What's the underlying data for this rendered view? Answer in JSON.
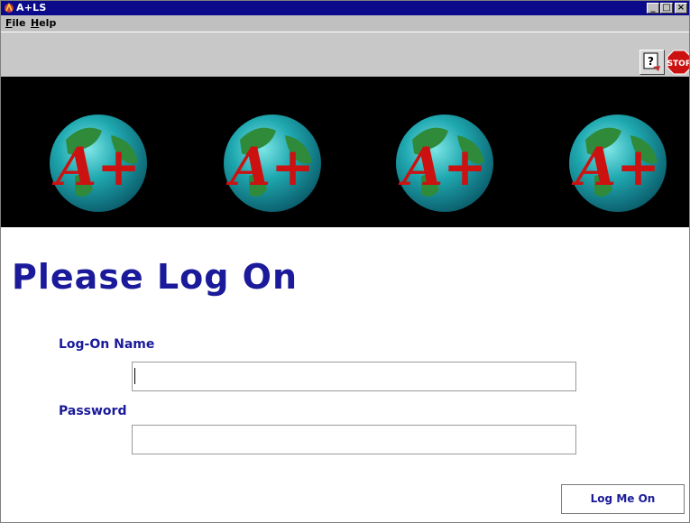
{
  "window": {
    "title": "A+LS",
    "colors": {
      "titlebar": "#0a0a8a",
      "accent_text": "#1a1a9a",
      "banner": "#000000"
    }
  },
  "window_controls": {
    "minimize": "_",
    "maximize": "□",
    "close": "×"
  },
  "menubar": {
    "items": [
      {
        "first": "F",
        "rest": "ile"
      },
      {
        "first": "H",
        "rest": "elp"
      }
    ]
  },
  "toolbar": {
    "help_icon": "help-book-icon",
    "stop_icon": "stop-sign-icon",
    "stop_text": "STOP"
  },
  "banner": {
    "logo_text": "A+",
    "logo_icon": "globe-logo-icon"
  },
  "form": {
    "heading": "Please Log On",
    "name_label": "Log-On Name",
    "name_value": "",
    "password_label": "Password",
    "password_value": "",
    "submit_label": "Log Me On"
  }
}
